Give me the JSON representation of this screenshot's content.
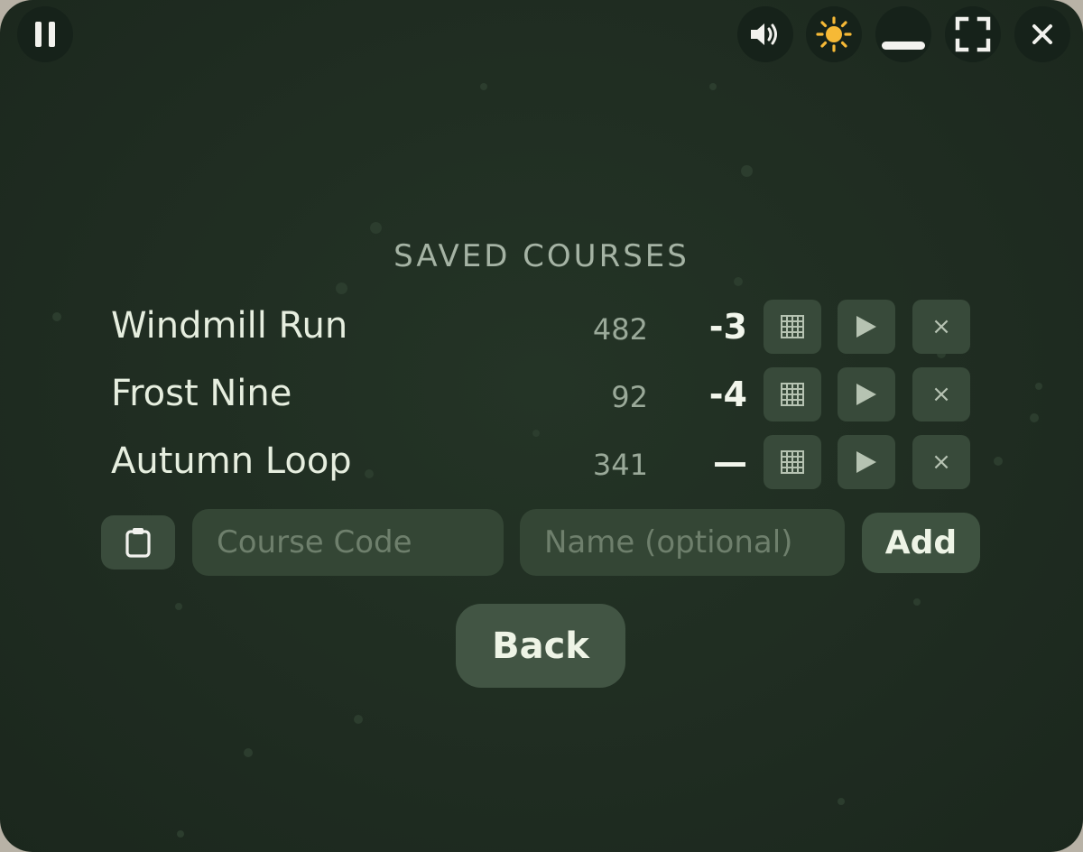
{
  "controls": {
    "pause_icon": "pause-icon",
    "sound_icon": "speaker-icon",
    "theme_icon": "sun-icon",
    "minimize_icon": "minimize-icon",
    "fullscreen_icon": "fullscreen-icon",
    "close_icon": "close-icon",
    "theme_color": "#f6b936"
  },
  "title": "SAVED COURSES",
  "courses": [
    {
      "name": "Windmill Run",
      "length": "482",
      "score": "-3"
    },
    {
      "name": "Frost Nine",
      "length": "92",
      "score": "-4"
    },
    {
      "name": "Autumn Loop",
      "length": "341",
      "score": "—"
    }
  ],
  "row_actions": {
    "grid_icon": "grid-icon",
    "play_label": "▶",
    "delete_label": "×"
  },
  "add_form": {
    "code_placeholder": "Course Code",
    "name_placeholder": "Name (optional)",
    "add_label": "Add",
    "paste_icon": "clipboard-icon"
  },
  "back_label": "Back"
}
